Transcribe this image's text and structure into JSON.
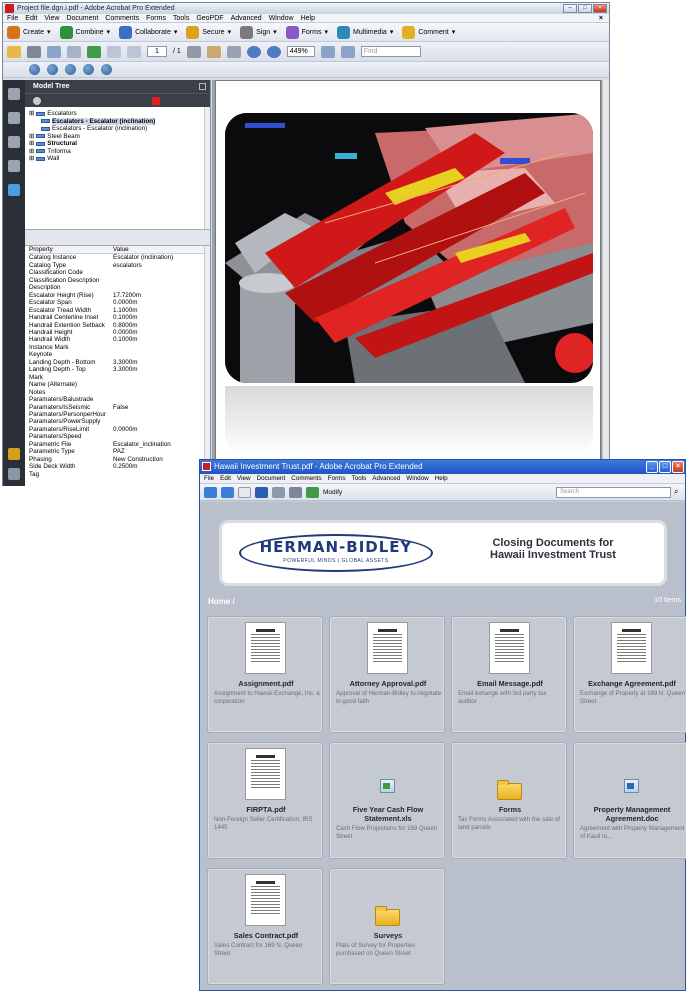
{
  "win1": {
    "title": "Project file.dgn.i.pdf - Adobe Acrobat Pro Extended",
    "menu": [
      "File",
      "Edit",
      "View",
      "Document",
      "Comments",
      "Forms",
      "Tools",
      "GeoPDF",
      "Advanced",
      "Window",
      "Help"
    ],
    "tasks": [
      {
        "label": "Create",
        "color": "#d9731a"
      },
      {
        "label": "Combine",
        "color": "#2f8f3a"
      },
      {
        "label": "Collaborate",
        "color": "#3a6fc4"
      },
      {
        "label": "Secure",
        "color": "#d9a21a"
      },
      {
        "label": "Sign",
        "color": "#7a7a7a"
      },
      {
        "label": "Forms",
        "color": "#8a5ac4"
      },
      {
        "label": "Multimedia",
        "color": "#2a8ab8"
      },
      {
        "label": "Comment",
        "color": "#e0b020"
      }
    ],
    "page_current": "1",
    "page_total": "/ 1",
    "zoom": "449%",
    "find_placeholder": "Find",
    "panel_title": "Model Tree",
    "tree": [
      {
        "label": "Escalators",
        "indent": 0
      },
      {
        "label": "Escalators - Escalator (inclination)",
        "indent": 1,
        "selected": true
      },
      {
        "label": "Escalators - Escalator (inclination)",
        "indent": 1
      },
      {
        "label": "Steel Beam",
        "indent": 0
      },
      {
        "label": "Structural",
        "indent": 0,
        "bold": true
      },
      {
        "label": "Tnforma",
        "indent": 0
      },
      {
        "label": "Wall",
        "indent": 0
      }
    ],
    "props_header": {
      "k": "Property",
      "v": "Value"
    },
    "props": [
      [
        "Catalog Instance",
        "Escalator (inclination)"
      ],
      [
        "Catalog Type",
        "escalators"
      ],
      [
        "Classification Code",
        ""
      ],
      [
        "Classification Description",
        ""
      ],
      [
        "Description",
        ""
      ],
      [
        "Escalator Height (Rise)",
        "17.7200m"
      ],
      [
        "Escalator Span",
        "0.0000m"
      ],
      [
        "Escalator Tread Width",
        "1.1000m"
      ],
      [
        "Handrail Centerline Inset",
        "0.1000m"
      ],
      [
        "Handrail Extention Setback",
        "0.8000m"
      ],
      [
        "Handrail Height",
        "0.0000m"
      ],
      [
        "Handrail Width",
        "0.1000m"
      ],
      [
        "Instance Mark",
        ""
      ],
      [
        "Keynote",
        ""
      ],
      [
        "Landing Depth - Bottom",
        "3.3000m"
      ],
      [
        "Landing Depth - Top",
        "3.3000m"
      ],
      [
        "Mark",
        ""
      ],
      [
        "Name (Alternate)",
        ""
      ],
      [
        "Notes",
        ""
      ],
      [
        "Paramaters/Balustrade",
        ""
      ],
      [
        "Paramaters/IsSeismic",
        "False"
      ],
      [
        "Paramaters/PersonperHour",
        ""
      ],
      [
        "Paramaters/PowerSupply",
        ""
      ],
      [
        "Paramaters/RiseLimit",
        "0.0000m"
      ],
      [
        "Paramaters/Speed",
        ""
      ],
      [
        "Parametric File",
        "Escalator_inclination"
      ],
      [
        "Parametric Type",
        "PAZ"
      ],
      [
        "Phasing",
        "New Construction"
      ],
      [
        "Side Deck Width",
        "0.2500m"
      ],
      [
        "Tag",
        ""
      ]
    ]
  },
  "win2": {
    "title": "Hawaii Investment Trust.pdf - Adobe Acrobat Pro Extended",
    "menu": [
      "File",
      "Edit",
      "View",
      "Document",
      "Comments",
      "Forms",
      "Tools",
      "Advanced",
      "Window",
      "Help"
    ],
    "modify_label": "Modify",
    "search_placeholder": "Search",
    "logo_text": "HERMAN-BIDLEY",
    "logo_tagline": "POWERFUL MINDS | GLOBAL ASSETS",
    "banner_title_1": "Closing Documents for",
    "banner_title_2": "Hawaii Investment Trust",
    "breadcrumb": "Home /",
    "item_count": "10 Items",
    "cards": [
      {
        "name": "Assignment.pdf",
        "desc": "Assignment to Hawaii Exchange, Inc. a corporation",
        "kind": "doc"
      },
      {
        "name": "Attorney Approval.pdf",
        "desc": "Approval of Herman-Bidley to negotate in good faith",
        "kind": "doc"
      },
      {
        "name": "Email Message.pdf",
        "desc": "Email exhange with 3rd party tax auditor",
        "kind": "doc"
      },
      {
        "name": "Exchange Agreement.pdf",
        "desc": "Exchange of Property at 169 N. Queen Street",
        "kind": "doc"
      },
      {
        "name": "FIRPTA.pdf",
        "desc": "Non-Foreign Seller Certification, IRS 1445",
        "kind": "doc"
      },
      {
        "name": "Five Year Cash Flow Statement.xls",
        "desc": "Cash Flow Projections for 169 Queen Street",
        "kind": "xls"
      },
      {
        "name": "Forms",
        "desc": "Tax Forms Associated with the sale of land parcels",
        "kind": "folder"
      },
      {
        "name": "Property Management Agreement.doc",
        "desc": "Agreement with Property Management of Kauil to...",
        "kind": "word"
      },
      {
        "name": "Sales Contract.pdf",
        "desc": "Sales Contract for 169 N. Queen Street",
        "kind": "doc"
      },
      {
        "name": "Surveys",
        "desc": "Plats of Survey for Properties purchased on Queen Street",
        "kind": "folder"
      }
    ]
  }
}
